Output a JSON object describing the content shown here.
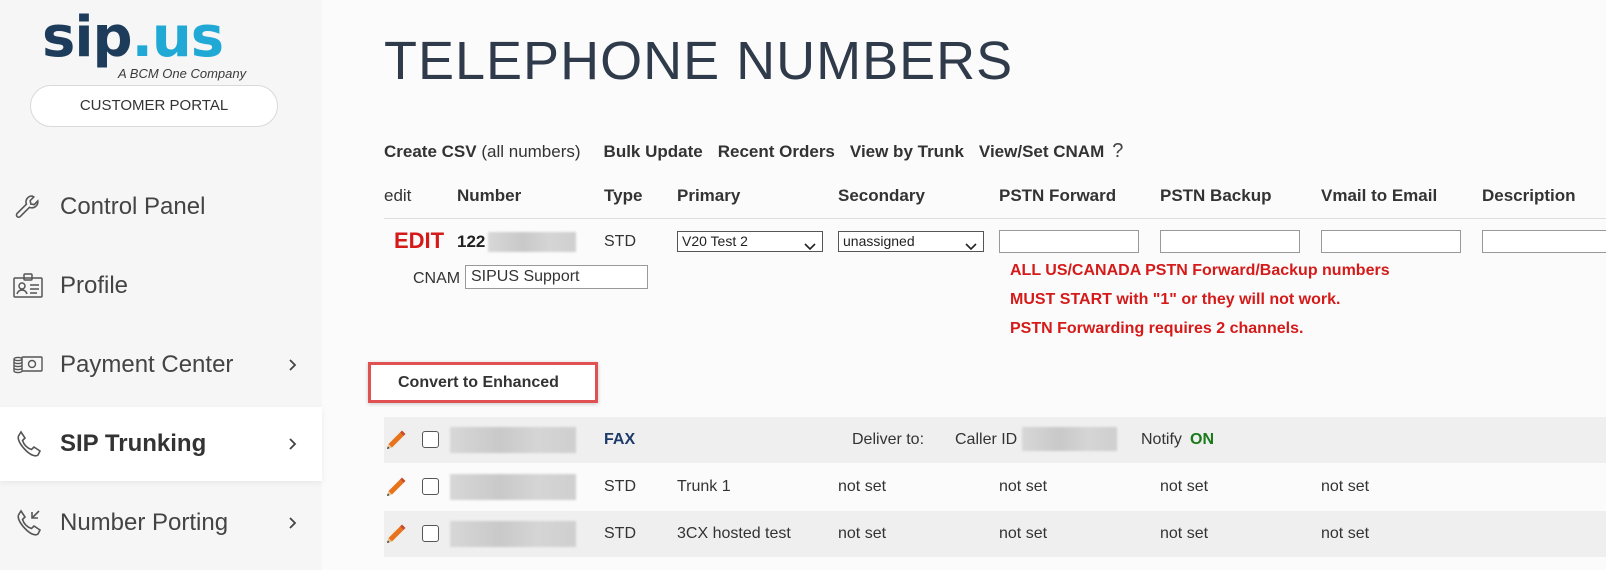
{
  "brand": {
    "logo_sip": "sip",
    "logo_dot": ".",
    "logo_us": "us",
    "logo_tagline": "A BCM One Company",
    "portal_button": "CUSTOMER PORTAL"
  },
  "sidebar": {
    "items": [
      {
        "label": "Control Panel",
        "icon": "wrench-icon",
        "active": false,
        "has_chevron": false
      },
      {
        "label": "Profile",
        "icon": "id-card-icon",
        "active": false,
        "has_chevron": false
      },
      {
        "label": "Payment Center",
        "icon": "cash-icon",
        "active": false,
        "has_chevron": true
      },
      {
        "label": "SIP Trunking",
        "icon": "phone-icon",
        "active": true,
        "has_chevron": true
      },
      {
        "label": "Number Porting",
        "icon": "phone-incoming-icon",
        "active": false,
        "has_chevron": true
      }
    ]
  },
  "page": {
    "title": "TELEPHONE NUMBERS"
  },
  "toolbar": {
    "create_csv": "Create CSV",
    "create_csv_note": "(all numbers)",
    "bulk_update": "Bulk Update",
    "recent_orders": "Recent Orders",
    "view_by_trunk": "View by Trunk",
    "view_set_cnam": "View/Set CNAM",
    "help": "?"
  },
  "table": {
    "headers": {
      "edit": "edit",
      "number": "Number",
      "type": "Type",
      "primary": "Primary",
      "secondary": "Secondary",
      "pstn_forward": "PSTN Forward",
      "pstn_backup": "PSTN Backup",
      "vmail": "Vmail to Email",
      "description": "Description"
    },
    "edit_row": {
      "edit_label": "EDIT",
      "number_prefix": "122",
      "type": "STD",
      "primary_value": "V20 Test 2",
      "secondary_value": "unassigned",
      "cnam_label": "CNAM",
      "cnam_value": "SIPUS Support",
      "pstn_forward_value": "",
      "pstn_backup_value": "",
      "vmail_value": "",
      "description_value": ""
    },
    "warnings": [
      "ALL US/CANADA PSTN Forward/Backup numbers",
      "MUST START with \"1\" or they will not work.",
      "PSTN Forwarding requires 2 channels."
    ],
    "convert_button": "Convert to Enhanced",
    "fax_row": {
      "type": "FAX",
      "deliver_to": "Deliver to:",
      "caller_id": "Caller ID",
      "notify": "Notify",
      "notify_state": "ON"
    },
    "rows": [
      {
        "type": "STD",
        "primary": "Trunk 1",
        "secondary": "not set",
        "pstn_forward": "not set",
        "pstn_backup": "not set",
        "vmail": "not set"
      },
      {
        "type": "STD",
        "primary": "3CX hosted test",
        "secondary": "not set",
        "pstn_forward": "not set",
        "pstn_backup": "not set",
        "vmail": "not set"
      }
    ]
  },
  "colors": {
    "brand_dark": "#1d3b5a",
    "brand_light": "#21a9d6",
    "alert_red": "#d51a1a",
    "on_green": "#1a7a1a",
    "highlight_border": "#e05252"
  }
}
